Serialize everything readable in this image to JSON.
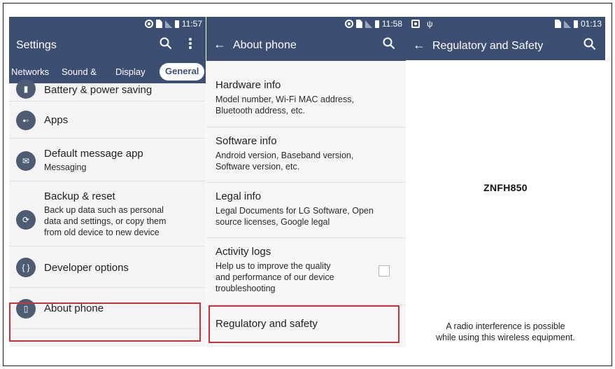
{
  "panel1": {
    "status_time": "11:57",
    "title": "Settings",
    "tabs": [
      "Networks",
      "Sound &",
      "Display",
      "General"
    ],
    "items": [
      {
        "title": "Battery & power saving",
        "subtitle": ""
      },
      {
        "title": "Apps",
        "subtitle": ""
      },
      {
        "title": "Default message app",
        "subtitle": "Messaging"
      },
      {
        "title": "Backup & reset",
        "subtitle_lines": [
          "Back up data such as personal",
          "data and settings, or copy them",
          "from old device to new device"
        ]
      },
      {
        "title": "Developer options",
        "subtitle": ""
      },
      {
        "title": "About phone",
        "subtitle": ""
      }
    ]
  },
  "panel2": {
    "status_time": "11:58",
    "title": "About phone",
    "items": [
      {
        "title": "Hardware info",
        "subtitle_lines": [
          "Model number, Wi-Fi MAC address,",
          "Bluetooth address, etc."
        ]
      },
      {
        "title": "Software info",
        "subtitle_lines": [
          "Android version, Baseband version,",
          "Software version, etc."
        ]
      },
      {
        "title": "Legal info",
        "subtitle_lines": [
          "Legal Documents for LG Software, Open",
          "source licenses, Google legal"
        ]
      },
      {
        "title": "Activity logs",
        "subtitle_lines": [
          "Help us to improve the quality",
          "and performance of our device",
          "troubleshooting"
        ]
      },
      {
        "title": "Regulatory and safety"
      }
    ]
  },
  "panel3": {
    "status_time": "01:13",
    "title": "Regulatory and Safety",
    "model": "ZNFH850",
    "notice_lines": [
      "A radio interference is possible",
      "while using this wireless equipment."
    ]
  },
  "colors": {
    "appbar": "#3c4f73",
    "highlight": "#c7333a"
  }
}
